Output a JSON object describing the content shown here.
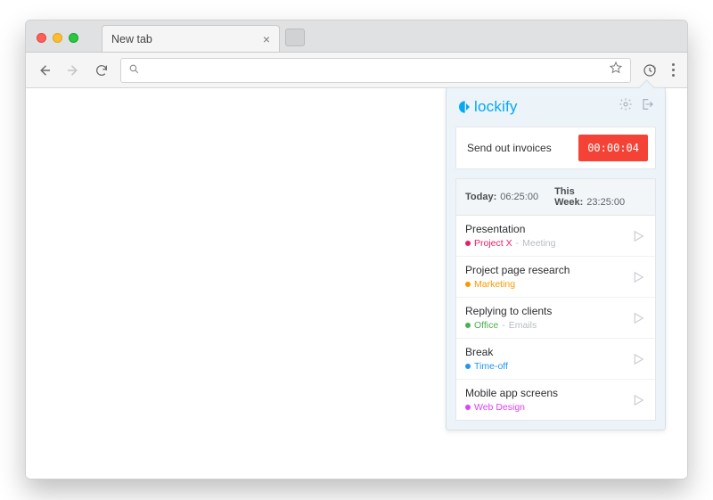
{
  "browser": {
    "tab_title": "New tab",
    "omnibox_value": "",
    "omnibox_placeholder": ""
  },
  "popup": {
    "brand": "lockify",
    "tracker": {
      "description": "Send out invoices",
      "timer": "00:00:04"
    },
    "summary": {
      "today_label": "Today:",
      "today_value": "06:25:00",
      "week_label": "This Week:",
      "week_value": "23:25:00"
    },
    "entries": [
      {
        "title": "Presentation",
        "project": "Project X",
        "tag": "Meeting",
        "color": "#e91e63"
      },
      {
        "title": "Project page research",
        "project": "Marketing",
        "tag": "",
        "color": "#ff9800"
      },
      {
        "title": "Replying to clients",
        "project": "Office",
        "tag": "Emails",
        "color": "#4caf50"
      },
      {
        "title": "Break",
        "project": "Time-off",
        "tag": "",
        "color": "#2196f3"
      },
      {
        "title": "Mobile app screens",
        "project": "Web Design",
        "tag": "",
        "color": "#e040fb"
      }
    ]
  }
}
